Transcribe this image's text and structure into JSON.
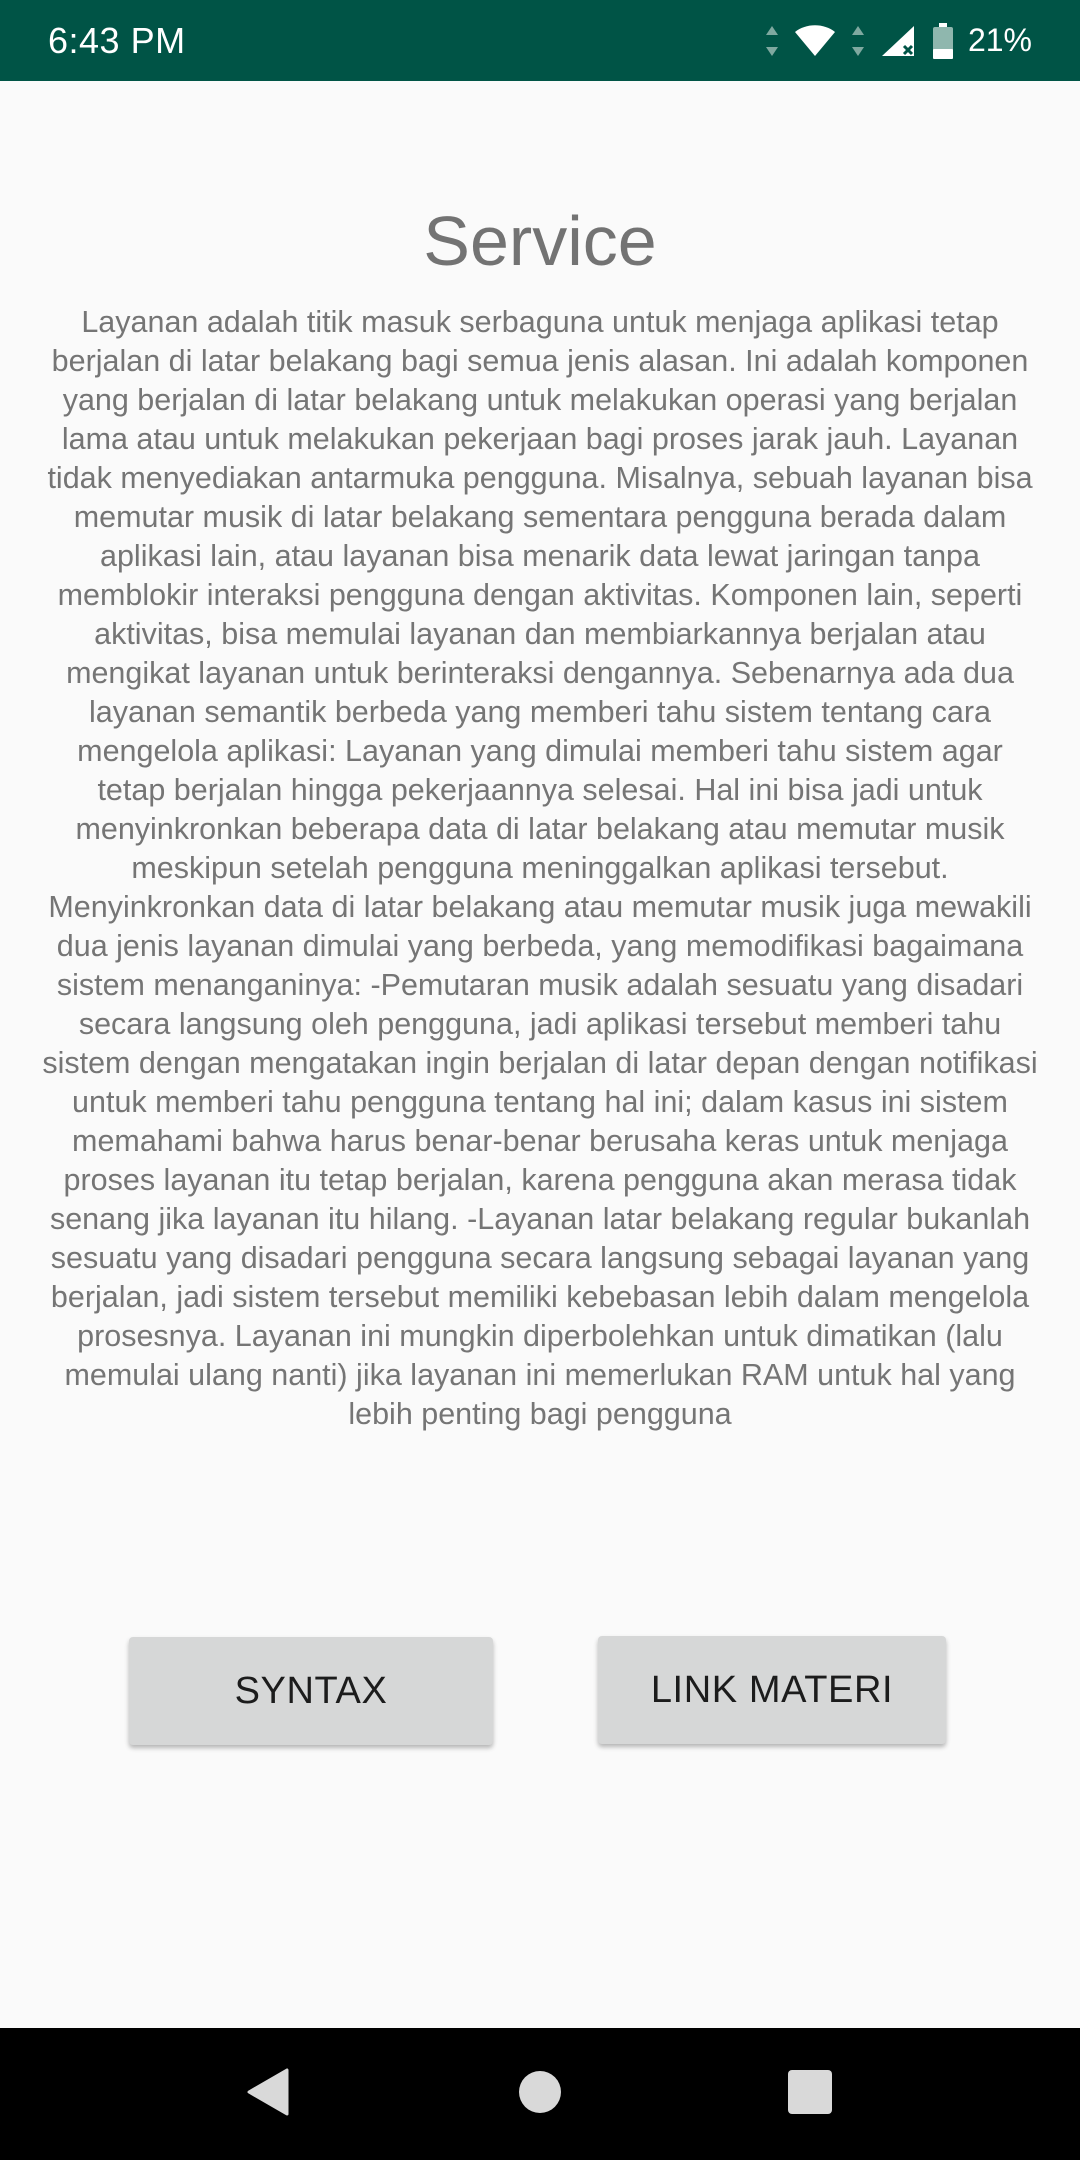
{
  "status_bar": {
    "time": "6:43 PM",
    "battery_percent": "21%",
    "background_color": "#005446",
    "icons": [
      "data-arrows-icon",
      "wifi-icon",
      "cell-signal-icon",
      "battery-icon"
    ]
  },
  "page": {
    "title": "Service",
    "body": "Layanan adalah titik masuk serbaguna untuk menjaga aplikasi tetap berjalan di latar belakang bagi semua jenis alasan. Ini adalah komponen yang berjalan di latar belakang untuk melakukan operasi yang berjalan lama atau untuk melakukan pekerjaan bagi proses jarak jauh. Layanan tidak menyediakan antarmuka pengguna. Misalnya, sebuah layanan bisa memutar musik di latar belakang sementara pengguna berada dalam aplikasi lain, atau layanan bisa menarik data lewat jaringan tanpa memblokir interaksi pengguna dengan aktivitas. Komponen lain, seperti aktivitas, bisa memulai layanan dan membiarkannya berjalan atau mengikat layanan untuk berinteraksi dengannya. Sebenarnya ada dua layanan semantik berbeda yang memberi tahu sistem tentang cara mengelola aplikasi: Layanan yang dimulai memberi tahu sistem agar tetap berjalan hingga pekerjaannya selesai. Hal ini bisa jadi untuk menyinkronkan beberapa data di latar belakang atau memutar musik meskipun setelah pengguna meninggalkan aplikasi tersebut. Menyinkronkan data di latar belakang atau memutar musik juga mewakili dua jenis layanan dimulai yang berbeda, yang memodifikasi bagaimana sistem menanganinya: -Pemutaran musik adalah sesuatu yang disadari secara langsung oleh pengguna, jadi aplikasi tersebut memberi tahu sistem dengan mengatakan ingin berjalan di latar depan dengan notifikasi untuk memberi tahu pengguna tentang hal ini; dalam kasus ini sistem memahami bahwa harus benar-benar berusaha keras untuk menjaga proses layanan itu tetap berjalan, karena pengguna akan merasa tidak senang jika layanan itu hilang. -Layanan latar belakang regular bukanlah sesuatu yang disadari pengguna secara langsung sebagai layanan yang berjalan, jadi sistem tersebut memiliki kebebasan lebih dalam mengelola prosesnya. Layanan ini mungkin diperbolehkan untuk dimatikan (lalu memulai ulang nanti) jika layanan ini memerlukan RAM untuk hal yang lebih penting bagi pengguna"
  },
  "buttons": {
    "syntax_label": "SYNTAX",
    "link_materi_label": "LINK MATERI"
  },
  "nav_bar": {
    "icons": [
      "back-icon",
      "home-icon",
      "recents-icon"
    ]
  }
}
